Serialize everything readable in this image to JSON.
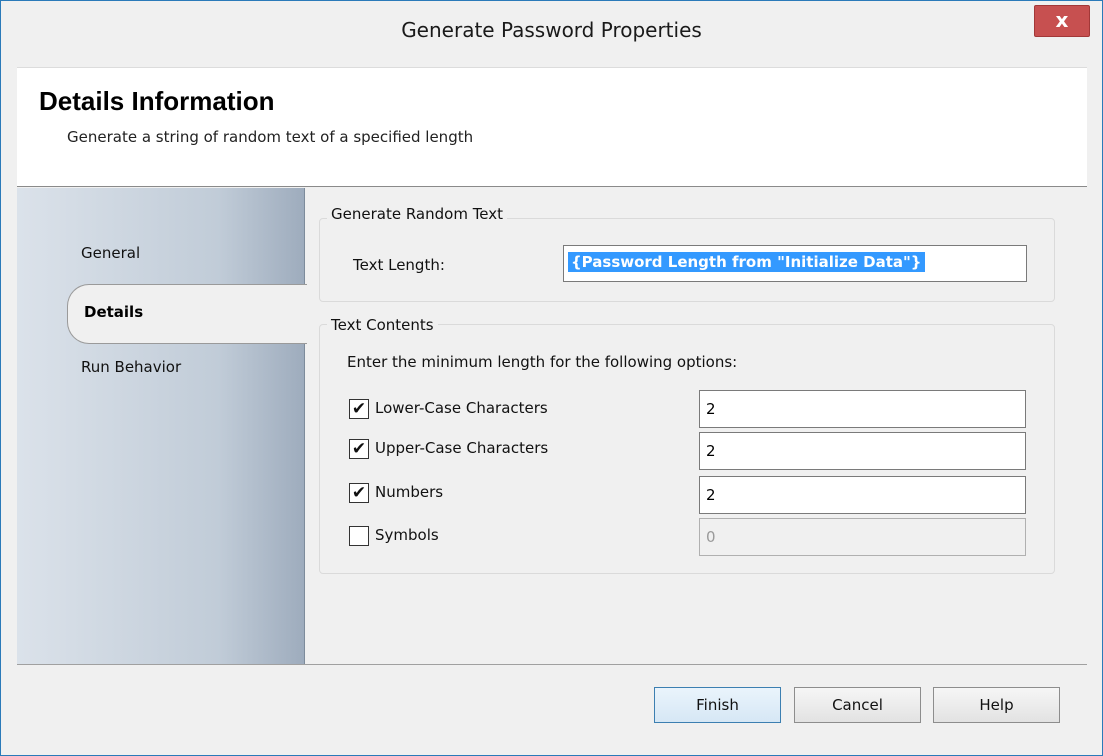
{
  "window": {
    "title": "Generate Password Properties",
    "close_label": "x"
  },
  "header": {
    "heading": "Details Information",
    "subheading": "Generate a string of random text of a specified length"
  },
  "sidebar": {
    "items": [
      {
        "label": "General",
        "active": false
      },
      {
        "label": "Details",
        "active": true
      },
      {
        "label": "Run Behavior",
        "active": false
      }
    ]
  },
  "random_text_group": {
    "legend": "Generate Random Text",
    "text_length_label": "Text Length:",
    "text_length_value": "{Password Length from \"Initialize Data\"}"
  },
  "text_contents_group": {
    "legend": "Text Contents",
    "instruction": "Enter the minimum length for the following options:",
    "options": [
      {
        "label": "Lower-Case Characters",
        "checked": true,
        "value": "2",
        "enabled": true
      },
      {
        "label": "Upper-Case Characters",
        "checked": true,
        "value": "2",
        "enabled": true
      },
      {
        "label": "Numbers",
        "checked": true,
        "value": "2",
        "enabled": true
      },
      {
        "label": "Symbols",
        "checked": false,
        "value": "0",
        "enabled": false
      }
    ]
  },
  "footer": {
    "finish_label": "Finish",
    "cancel_label": "Cancel",
    "help_label": "Help"
  },
  "colors": {
    "selection": "#3399ff",
    "close_button": "#c75050",
    "window_border": "#2a7ab9"
  }
}
